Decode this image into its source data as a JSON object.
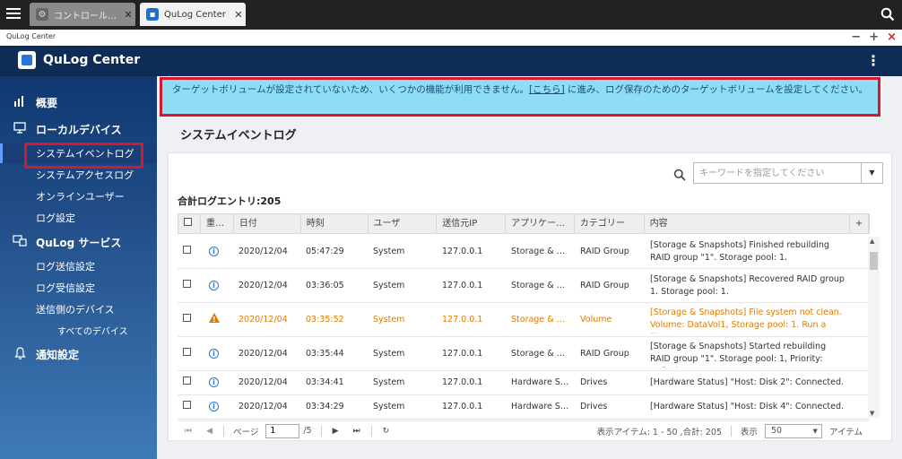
{
  "browser": {
    "tabs": [
      {
        "label": "コントロール…",
        "icon": "gear-icon"
      },
      {
        "label": "QuLog Center",
        "icon": "qulog-icon"
      }
    ]
  },
  "window": {
    "title": "QuLog Center",
    "controls": [
      "−",
      "+",
      "×"
    ]
  },
  "app": {
    "title": "QuLog Center"
  },
  "sidebar": {
    "overview": "概要",
    "local_devices": "ローカルデバイス",
    "system_event_log": "システムイベントログ",
    "system_access_log": "システムアクセスログ",
    "online_users": "オンラインユーザー",
    "log_settings": "ログ設定",
    "qulog_service": "QuLog サービス",
    "log_send_settings": "ログ送信設定",
    "log_receive_settings": "ログ受信設定",
    "sender_devices": "送信側のデバイス",
    "all_devices": "すべてのデバイス",
    "notification_settings": "通知設定"
  },
  "banner": {
    "text_before": "ターゲットボリュームが設定されていないため、いくつかの機能が利用できません。",
    "link": "[こちら]",
    "text_after": " に進み、ログ保存のためのターゲットボリュームを設定してください。"
  },
  "page": {
    "title": "システムイベントログ",
    "search_placeholder": "キーワードを指定してください",
    "total_label": "合計ログエントリ:205"
  },
  "table": {
    "headers": [
      "重…",
      "日付",
      "時刻",
      "ユーザ",
      "送信元IP",
      "アプリケー…",
      "カテゴリー",
      "内容",
      "+"
    ],
    "rows": [
      {
        "sev": "info",
        "date": "2020/12/04",
        "time": "05:47:29",
        "user": "System",
        "ip": "127.0.0.1",
        "app": "Storage & …",
        "cat": "RAID Group",
        "content": "[Storage & Snapshots] Finished rebuilding RAID group \"1\". Storage pool: 1."
      },
      {
        "sev": "info",
        "date": "2020/12/04",
        "time": "03:36:05",
        "user": "System",
        "ip": "127.0.0.1",
        "app": "Storage & …",
        "cat": "RAID Group",
        "content": "[Storage & Snapshots] Recovered RAID group 1. Storage pool: 1."
      },
      {
        "sev": "warn",
        "date": "2020/12/04",
        "time": "03:35:52",
        "user": "System",
        "ip": "127.0.0.1",
        "app": "Storage & …",
        "cat": "Volume",
        "content": "[Storage & Snapshots] File system not clean. Volume: DataVol1, Storage pool: 1. Run a file..."
      },
      {
        "sev": "info",
        "date": "2020/12/04",
        "time": "03:35:44",
        "user": "System",
        "ip": "127.0.0.1",
        "app": "Storage & …",
        "cat": "RAID Group",
        "content": "[Storage & Snapshots] Started rebuilding RAID group \"1\". Storage pool: 1, Priority: Default."
      },
      {
        "sev": "info",
        "date": "2020/12/04",
        "time": "03:34:41",
        "user": "System",
        "ip": "127.0.0.1",
        "app": "Hardware S…",
        "cat": "Drives",
        "content": "[Hardware Status] \"Host: Disk 2\": Connected."
      },
      {
        "sev": "info",
        "date": "2020/12/04",
        "time": "03:34:29",
        "user": "System",
        "ip": "127.0.0.1",
        "app": "Hardware S…",
        "cat": "Drives",
        "content": "[Hardware Status] \"Host: Disk 4\": Connected."
      }
    ]
  },
  "pager": {
    "page_label": "ページ",
    "page_value": "1",
    "total_pages": "/5",
    "items_info": "表示アイテム: 1 - 50 ,合計: 205",
    "show_label": "表示",
    "per_page": "50",
    "items_label": "アイテム"
  },
  "colors": {
    "warn": "#e07b00",
    "info": "#2b74d8",
    "banner": "#8fdcf5",
    "highlight": "#d6172d"
  }
}
